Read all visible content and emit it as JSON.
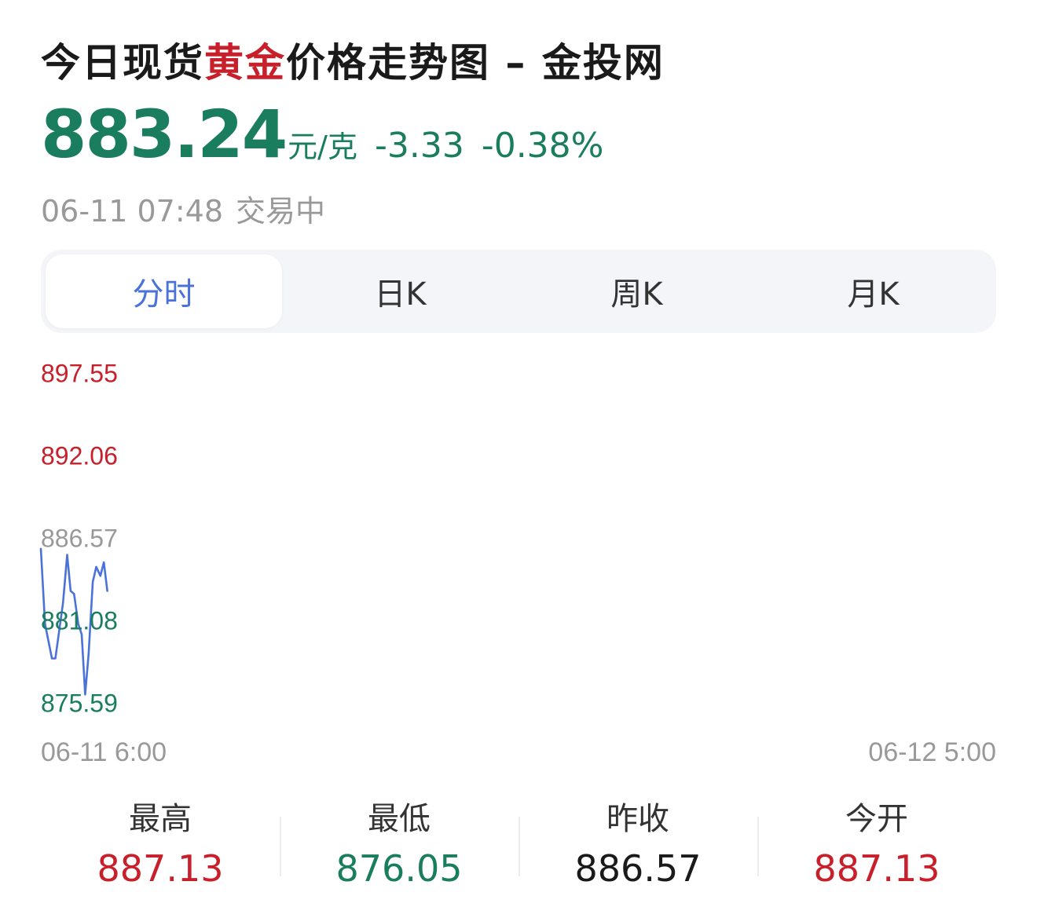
{
  "header": {
    "title_before": "今日现货",
    "title_highlight": "黄金",
    "title_after": "价格走势图 – 金投网"
  },
  "quote": {
    "price": "883.24",
    "unit": "元/克",
    "change": "-3.33",
    "change_pct": "-0.38%",
    "date_time": "06-11 07:48",
    "status": "交易中"
  },
  "tabs": [
    {
      "label": "分时"
    },
    {
      "label": "日K"
    },
    {
      "label": "周K"
    },
    {
      "label": "月K"
    }
  ],
  "colors": {
    "up": "#c8202a",
    "down": "#1a7d5e",
    "neutral": "#999999",
    "line": "#4a72d8",
    "active_tab": "#4a72d8"
  },
  "chart_data": {
    "type": "line",
    "title": "",
    "xlabel": "",
    "ylabel": "",
    "x_start_label": "06-11 6:00",
    "x_end_label": "06-12 5:00",
    "x_range_minutes": [
      0,
      1380
    ],
    "ylim": [
      875.59,
      897.55
    ],
    "reference_close": 886.57,
    "y_ticks": [
      {
        "label": "897.55",
        "value": 897.55,
        "tone": "up"
      },
      {
        "label": "892.06",
        "value": 892.06,
        "tone": "up"
      },
      {
        "label": "886.57",
        "value": 886.57,
        "tone": "neutral"
      },
      {
        "label": "881.08",
        "value": 881.08,
        "tone": "down"
      },
      {
        "label": "875.59",
        "value": 875.59,
        "tone": "down"
      }
    ],
    "grid": false,
    "series": [
      {
        "x": [
          0,
          6,
          16,
          21,
          32,
          38,
          43,
          48,
          54,
          59,
          64,
          69,
          75,
          80,
          86,
          91,
          96
        ],
        "y": [
          886.0,
          881.0,
          878.7,
          878.7,
          882.4,
          885.6,
          883.2,
          883.0,
          881.0,
          880.3,
          876.3,
          879.0,
          883.8,
          884.8,
          884.2,
          885.1,
          883.2
        ]
      }
    ]
  },
  "stats": [
    {
      "label": "最高",
      "value": "887.13",
      "tone": "up"
    },
    {
      "label": "最低",
      "value": "876.05",
      "tone": "down"
    },
    {
      "label": "昨收",
      "value": "886.57",
      "tone": "flat"
    },
    {
      "label": "今开",
      "value": "887.13",
      "tone": "up"
    }
  ]
}
